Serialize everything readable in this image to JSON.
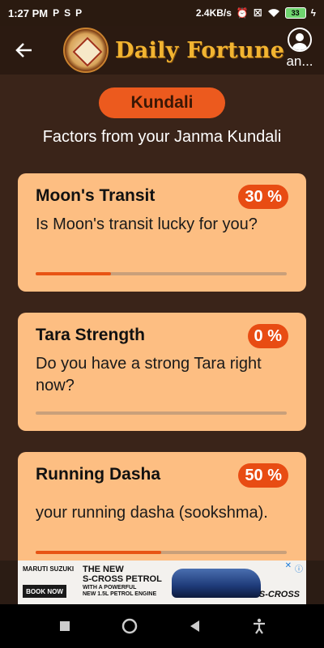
{
  "status_bar": {
    "time": "1:27 PM",
    "speed": "2.4KB/s",
    "battery": "33"
  },
  "header": {
    "title": "Daily Fortune",
    "user_name": "an..."
  },
  "section": {
    "pill_label": "Kundali",
    "subtitle": "Factors from your Janma Kundali"
  },
  "cards": [
    {
      "title": "Moon's Transit",
      "badge": "30 %",
      "description": "Is Moon's transit lucky for you?",
      "progress": 0.3
    },
    {
      "title": "Tara Strength",
      "badge": "0 %",
      "description": "Do you have a strong Tara right now?",
      "progress": 0.0
    },
    {
      "title": "Running Dasha",
      "badge": "50 %",
      "description": "your running dasha (sookshma).",
      "progress": 0.5
    }
  ],
  "ad": {
    "brand": "MARUTI SUZUKI",
    "headline_1": "THE NEW",
    "headline_2": "S-CROSS PETROL",
    "sub_1": "WITH A POWERFUL",
    "sub_2": "NEW 1.5L PETROL ENGINE",
    "book_label": "BOOK NOW",
    "model": "S-CROSS"
  },
  "colors": {
    "accent": "#ec5a1e",
    "card_bg": "#fdbe82",
    "title_gold": "#f2b431"
  }
}
